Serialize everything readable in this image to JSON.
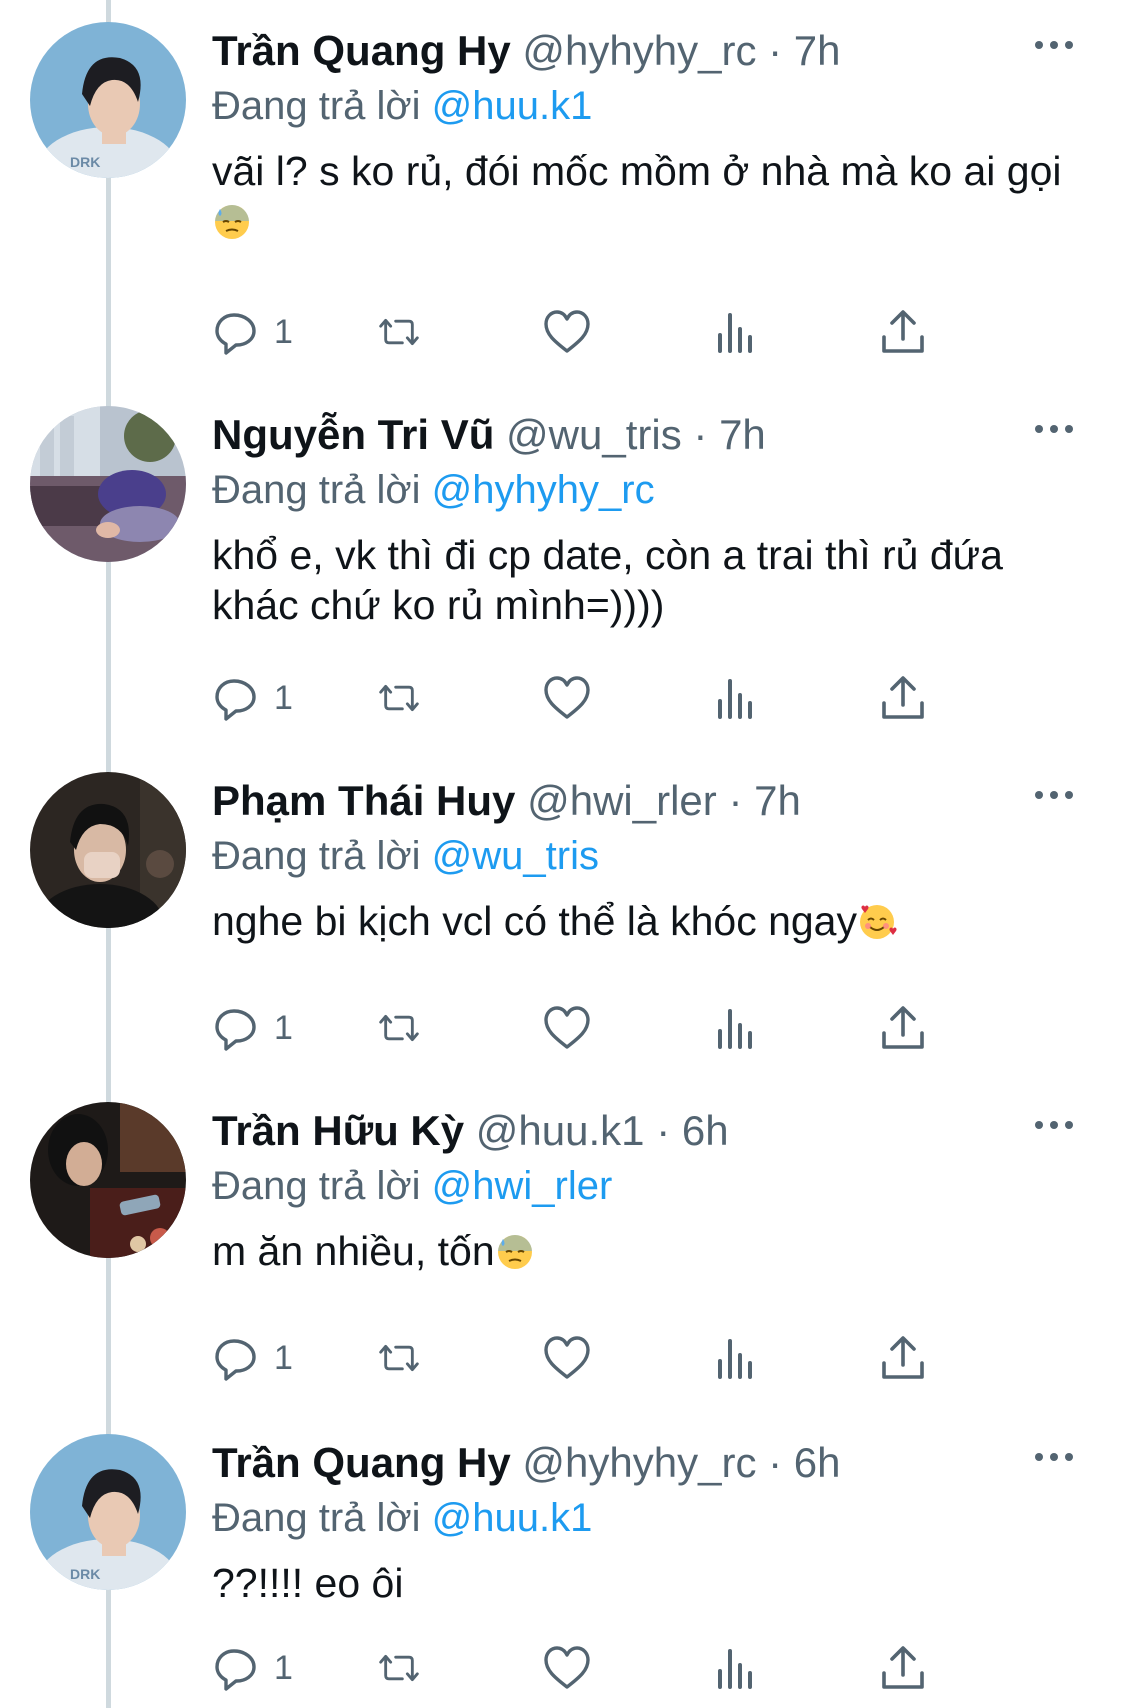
{
  "tweets": [
    {
      "name": "Trần Quang Hy",
      "handle": "@hyhyhy_rc",
      "dot": "·",
      "time": "7h",
      "reply_prefix": "Đang trả lời",
      "reply_to": "@huu.k1",
      "text": "vãi l? s ko rủ, đói mốc mồm ở nhà mà ko ai gọi",
      "emoji": "sweat-face",
      "reply_count": "1"
    },
    {
      "name": "Nguyễn Tri Vũ",
      "handle": "@wu_tris",
      "dot": "·",
      "time": "7h",
      "reply_prefix": "Đang trả lời",
      "reply_to": "@hyhyhy_rc",
      "text": "khổ e, vk thì đi cp date, còn a trai thì rủ đứa khác chứ ko rủ mình=))))",
      "emoji": "",
      "reply_count": "1"
    },
    {
      "name": "Phạm Thái Huy",
      "handle": "@hwi_rler",
      "dot": "·",
      "time": "7h",
      "reply_prefix": "Đang trả lời",
      "reply_to": "@wu_tris",
      "text": "nghe bi kịch vcl có thể là khóc ngay",
      "emoji": "smiling-face-with-hearts",
      "reply_count": "1"
    },
    {
      "name": "Trần Hữu Kỳ",
      "handle": "@huu.k1",
      "dot": "·",
      "time": "6h",
      "reply_prefix": "Đang trả lời",
      "reply_to": "@hwi_rler",
      "text": "m ăn nhiều, tốn",
      "emoji": "sweat-face",
      "reply_count": "1"
    },
    {
      "name": "Trần Quang Hy",
      "handle": "@hyhyhy_rc",
      "dot": "·",
      "time": "6h",
      "reply_prefix": "Đang trả lời",
      "reply_to": "@huu.k1",
      "text": "??!!!! eo ôi",
      "emoji": "",
      "reply_count": "1"
    }
  ],
  "icons": {
    "reply": "reply-icon",
    "retweet": "retweet-icon",
    "like": "heart-icon",
    "views": "views-icon",
    "share": "share-icon",
    "more": "more-icon"
  },
  "colors": {
    "text": "#0f1419",
    "secondary": "#536471",
    "link": "#1d9bf0",
    "thread_line": "#cfd9de"
  }
}
